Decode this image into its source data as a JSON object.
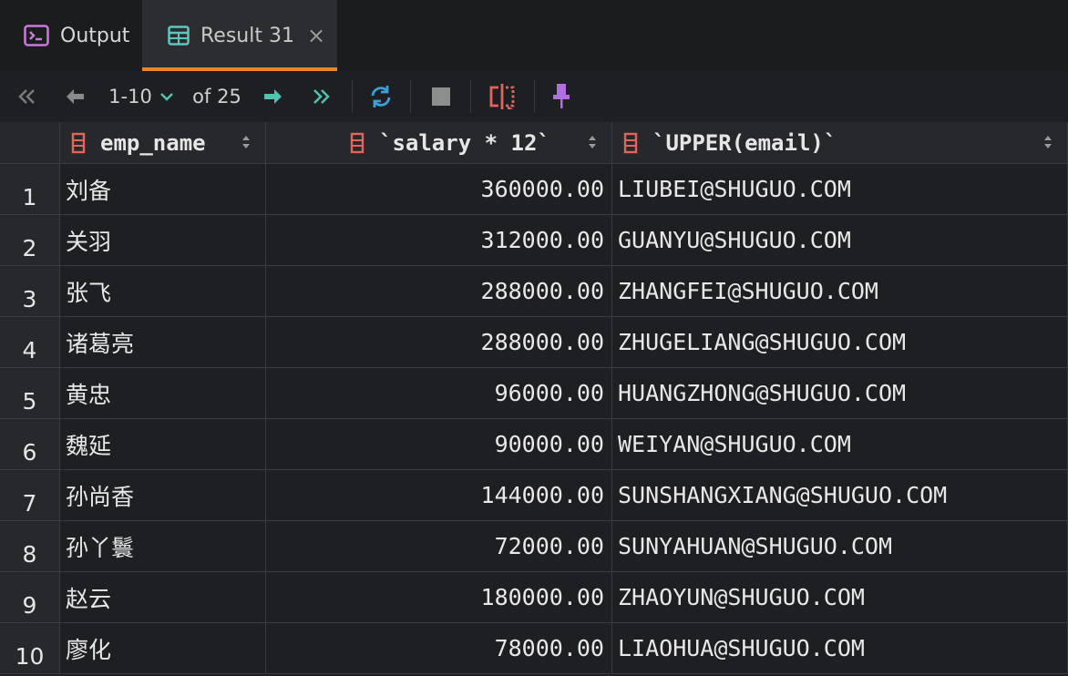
{
  "tabs": [
    {
      "label": "Output"
    },
    {
      "label": "Result 31",
      "close": "×"
    }
  ],
  "toolbar": {
    "page_range": "1-10",
    "of_total": "of 25"
  },
  "colors": {
    "accent": "#e8862a",
    "column_icon": "#e0665c",
    "nav_arrow": "#4fc3b0",
    "refresh": "#3aa0d8",
    "pin": "#b06ee0"
  },
  "columns": [
    {
      "label": "emp_name"
    },
    {
      "label": "`salary * 12`"
    },
    {
      "label": "`UPPER(email)`"
    }
  ],
  "rows": [
    {
      "num": "1",
      "name": "刘备",
      "salary": "360000.00",
      "email": "LIUBEI@SHUGUO.COM"
    },
    {
      "num": "2",
      "name": "关羽",
      "salary": "312000.00",
      "email": "GUANYU@SHUGUO.COM"
    },
    {
      "num": "3",
      "name": "张飞",
      "salary": "288000.00",
      "email": "ZHANGFEI@SHUGUO.COM"
    },
    {
      "num": "4",
      "name": "诸葛亮",
      "salary": "288000.00",
      "email": "ZHUGELIANG@SHUGUO.COM"
    },
    {
      "num": "5",
      "name": "黄忠",
      "salary": "96000.00",
      "email": "HUANGZHONG@SHUGUO.COM"
    },
    {
      "num": "6",
      "name": "魏延",
      "salary": "90000.00",
      "email": "WEIYAN@SHUGUO.COM"
    },
    {
      "num": "7",
      "name": "孙尚香",
      "salary": "144000.00",
      "email": "SUNSHANGXIANG@SHUGUO.COM"
    },
    {
      "num": "8",
      "name": "孙丫鬟",
      "salary": "72000.00",
      "email": "SUNYAHUAN@SHUGUO.COM"
    },
    {
      "num": "9",
      "name": "赵云",
      "salary": "180000.00",
      "email": "ZHAOYUN@SHUGUO.COM"
    },
    {
      "num": "10",
      "name": "廖化",
      "salary": "78000.00",
      "email": "LIAOHUA@SHUGUO.COM"
    }
  ]
}
